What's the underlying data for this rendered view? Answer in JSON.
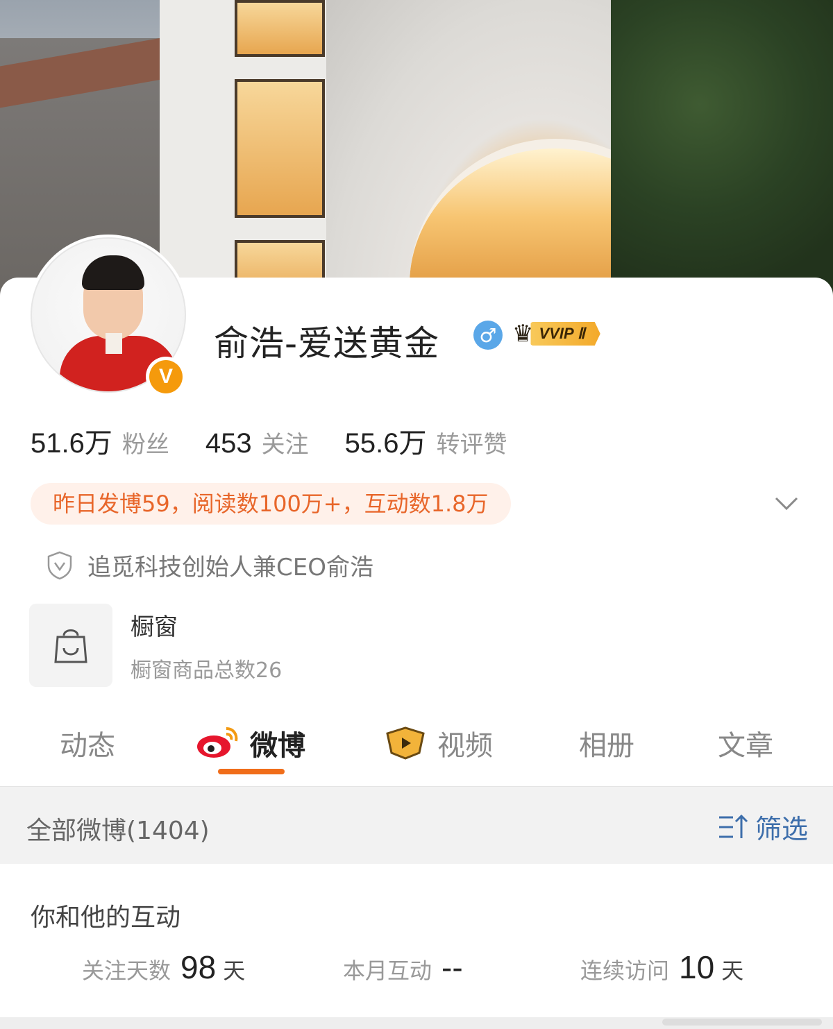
{
  "profile": {
    "name": "俞浩-爱送黄金",
    "gender_symbol": "♂",
    "verified_badge": "V",
    "vip_label": "VVIP Ⅱ",
    "stats": [
      {
        "num": "51.6万",
        "label": "粉丝"
      },
      {
        "num": "453",
        "label": "关注"
      },
      {
        "num": "55.6万",
        "label": "转评赞"
      }
    ],
    "summary": "昨日发博59，阅读数100万+，互动数1.8万",
    "description": "追觅科技创始人兼CEO俞浩"
  },
  "shop": {
    "title": "橱窗",
    "subtitle": "橱窗商品总数26"
  },
  "tabs": [
    {
      "label": "动态",
      "active": false
    },
    {
      "label": "微博",
      "active": true,
      "icon": "weibo-icon"
    },
    {
      "label": "视频",
      "active": false,
      "icon": "video-icon"
    },
    {
      "label": "相册",
      "active": false
    },
    {
      "label": "文章",
      "active": false
    }
  ],
  "feed": {
    "count_label": "全部微博(1404)",
    "filter_label": "筛选"
  },
  "interaction": {
    "title": "你和他的互动",
    "metrics": [
      {
        "label": "关注天数",
        "value": "98",
        "unit": "天"
      },
      {
        "label": "本月互动",
        "value": "--",
        "unit": ""
      },
      {
        "label": "连续访问",
        "value": "10",
        "unit": "天"
      }
    ]
  },
  "colors": {
    "accent": "#f06d1a",
    "summary_text": "#e8662a",
    "summary_bg": "#fff1ea",
    "filter_blue": "#3d6eab",
    "verified": "#f59a0c",
    "gender": "#5aa7e8"
  }
}
